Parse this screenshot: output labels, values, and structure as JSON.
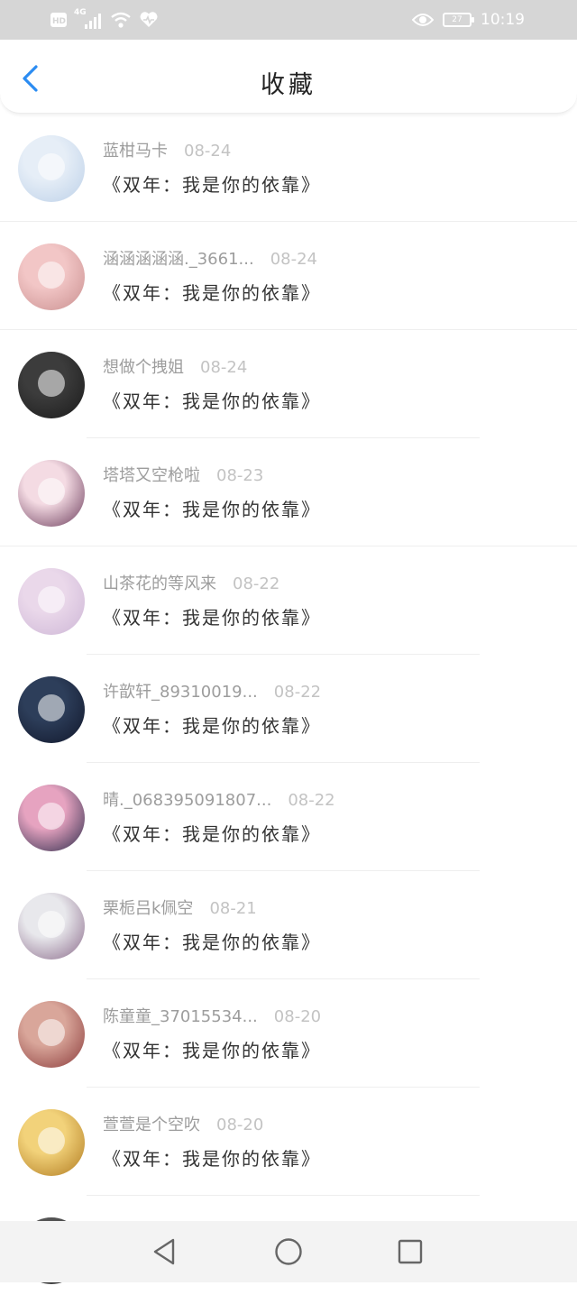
{
  "status_bar": {
    "hd": "HD",
    "network": "4G",
    "battery": "27",
    "time": "10:19"
  },
  "header": {
    "title": "收藏",
    "back_icon": "chevron-left-icon",
    "accent": "#2b8cf2"
  },
  "items": [
    {
      "name": "蓝柑马卡",
      "date": "08-24",
      "title": "《双年：我是你的依靠》",
      "colors": [
        "#e6eef7",
        "#bcd0e8"
      ]
    },
    {
      "name": "涵涵涵涵涵._3661...",
      "date": "08-24",
      "title": "《双年：我是你的依靠》",
      "colors": [
        "#f2c6c6",
        "#c98f8f"
      ]
    },
    {
      "name": "想做个拽姐",
      "date": "08-24",
      "title": "《双年：我是你的依靠》",
      "colors": [
        "#3c3c3c",
        "#1a1a1a"
      ]
    },
    {
      "name": "塔塔又空枪啦",
      "date": "08-23",
      "title": "《双年：我是你的依靠》",
      "colors": [
        "#f4dbe3",
        "#6a3a5a"
      ]
    },
    {
      "name": "山茶花的等风来",
      "date": "08-22",
      "title": "《双年：我是你的依靠》",
      "colors": [
        "#ead8ea",
        "#cdb6d6"
      ]
    },
    {
      "name": "许歆轩_89310019...",
      "date": "08-22",
      "title": "《双年：我是你的依靠》",
      "colors": [
        "#2d3e5a",
        "#10162a"
      ]
    },
    {
      "name": "晴._068395091807...",
      "date": "08-22",
      "title": "《双年：我是你的依靠》",
      "colors": [
        "#e6a3c0",
        "#2a2a4a"
      ]
    },
    {
      "name": "栗栀吕k佩空",
      "date": "08-21",
      "title": "《双年：我是你的依靠》",
      "colors": [
        "#e8e8ec",
        "#8a6a8a"
      ]
    },
    {
      "name": "陈童童_37015534...",
      "date": "08-20",
      "title": "《双年：我是你的依靠》",
      "colors": [
        "#d9a69a",
        "#8a3a3a"
      ]
    },
    {
      "name": "萱萱是个空吹",
      "date": "08-20",
      "title": "《双年：我是你的依靠》",
      "colors": [
        "#f2d27a",
        "#b07a20"
      ]
    }
  ],
  "partial_item": {
    "colors": [
      "#555555",
      "#333333"
    ]
  },
  "nav_bar": {
    "icons": [
      "back-triangle-icon",
      "home-circle-icon",
      "recents-square-icon"
    ]
  }
}
